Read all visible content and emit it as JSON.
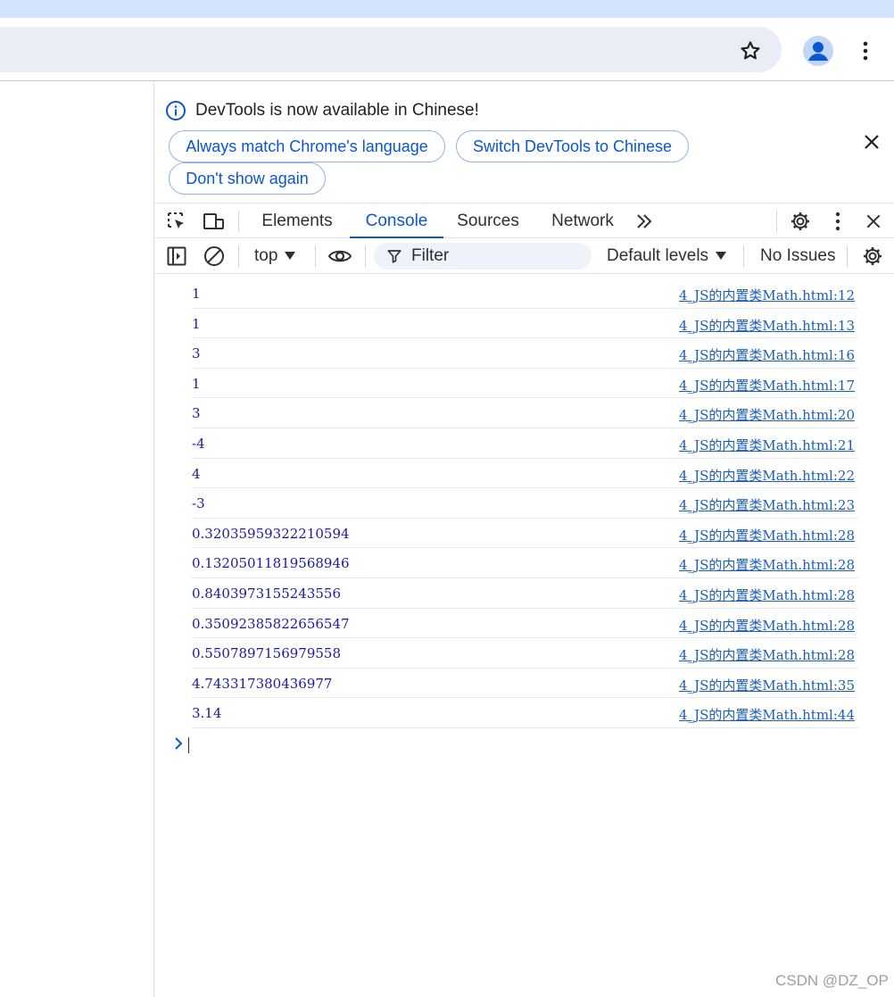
{
  "browser": {
    "star_icon": "star-outline-icon",
    "profile_icon": "person-icon",
    "menu_icon": "kebab-menu-icon"
  },
  "infobar": {
    "message": "DevTools is now available in Chinese!",
    "buttons": {
      "match_language": "Always match Chrome's language",
      "switch_chinese": "Switch DevTools to Chinese",
      "dont_show": "Don't show again"
    }
  },
  "tabs": {
    "elements": "Elements",
    "console": "Console",
    "sources": "Sources",
    "network": "Network"
  },
  "console_toolbar": {
    "context": "top",
    "filter_placeholder": "Filter",
    "levels": "Default levels",
    "issues": "No Issues"
  },
  "logs": [
    {
      "value": "1",
      "source": "4_JS的内置类Math.html:12"
    },
    {
      "value": "1",
      "source": "4_JS的内置类Math.html:13"
    },
    {
      "value": "3",
      "source": "4_JS的内置类Math.html:16"
    },
    {
      "value": "1",
      "source": "4_JS的内置类Math.html:17"
    },
    {
      "value": "3",
      "source": "4_JS的内置类Math.html:20"
    },
    {
      "value": "-4",
      "source": "4_JS的内置类Math.html:21"
    },
    {
      "value": "4",
      "source": "4_JS的内置类Math.html:22"
    },
    {
      "value": "-3",
      "source": "4_JS的内置类Math.html:23"
    },
    {
      "value": "0.32035959322210594",
      "source": "4_JS的内置类Math.html:28"
    },
    {
      "value": "0.13205011819568946",
      "source": "4_JS的内置类Math.html:28"
    },
    {
      "value": "0.8403973155243556",
      "source": "4_JS的内置类Math.html:28"
    },
    {
      "value": "0.35092385822656547",
      "source": "4_JS的内置类Math.html:28"
    },
    {
      "value": "0.5507897156979558",
      "source": "4_JS的内置类Math.html:28"
    },
    {
      "value": "4.743317380436977",
      "source": "4_JS的内置类Math.html:35"
    },
    {
      "value": "3.14",
      "source": "4_JS的内置类Math.html:44"
    }
  ],
  "watermark": "CSDN @DZ_OP",
  "colors": {
    "accent": "#0b57d0",
    "log_value": "#1a1aa6",
    "tabstrip": "#d3e3fd"
  }
}
